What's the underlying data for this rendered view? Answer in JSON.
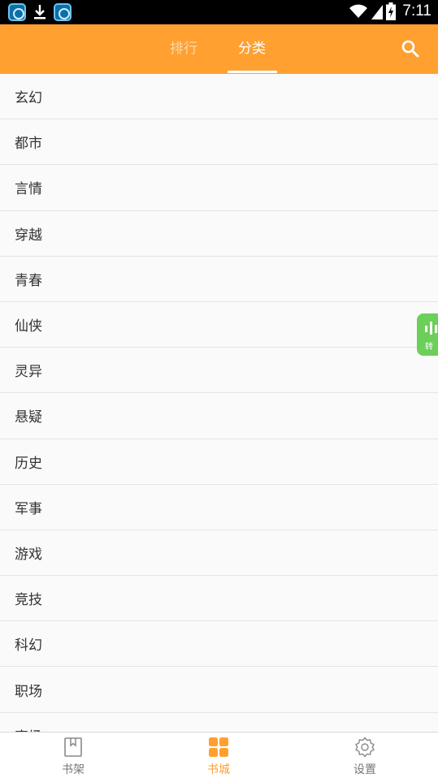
{
  "status_bar": {
    "time": "7:11",
    "icons": [
      "app-notification-icon",
      "app-notification-icon",
      "download-icon",
      "wifi-icon",
      "signal-icon",
      "battery-charging-icon"
    ]
  },
  "header": {
    "tabs": [
      {
        "label": "排行",
        "active": false
      },
      {
        "label": "分类",
        "active": true
      }
    ],
    "search_icon": "search-icon",
    "background": "#ffa031"
  },
  "categories": [
    "玄幻",
    "都市",
    "言情",
    "穿越",
    "青春",
    "仙侠",
    "灵异",
    "悬疑",
    "历史",
    "军事",
    "游戏",
    "竞技",
    "科幻",
    "职场",
    "官场"
  ],
  "float_button": {
    "label": "转",
    "icon": "sound-wave-icon",
    "color": "#6bcf5a"
  },
  "bottom_nav": {
    "items": [
      {
        "label": "书架",
        "icon": "bookshelf-icon",
        "active": false
      },
      {
        "label": "书城",
        "icon": "bookstore-grid-icon",
        "active": true
      },
      {
        "label": "设置",
        "icon": "settings-gear-icon",
        "active": false
      }
    ],
    "active_color": "#ffa031",
    "inactive_color": "#777777"
  }
}
